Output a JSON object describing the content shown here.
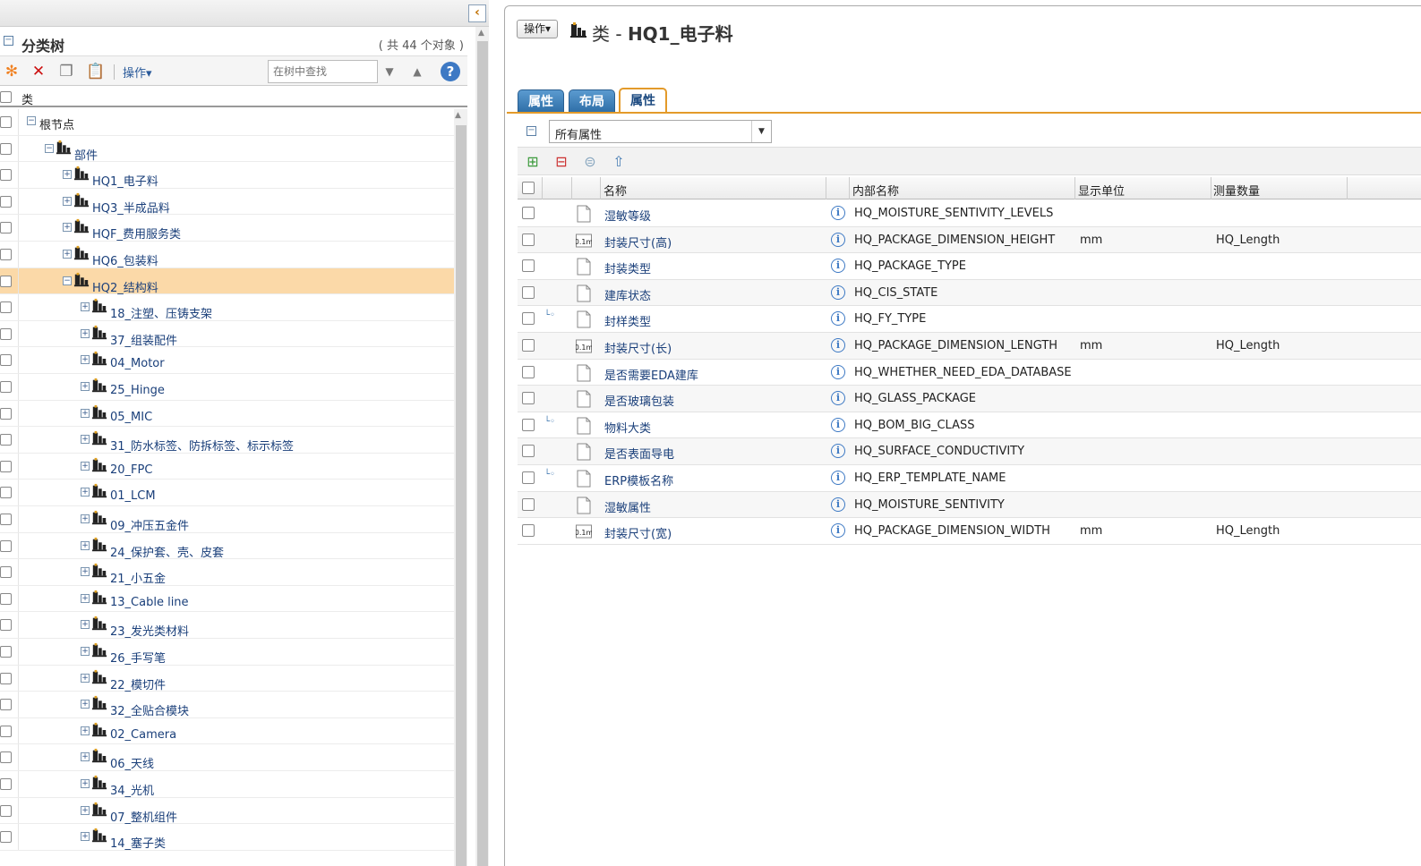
{
  "left_panel": {
    "tree_title": "分类树",
    "object_count": "( 共 44 个对象 )",
    "ops_label": "操作▾",
    "search_placeholder": "在树中查找",
    "column_label": "类",
    "tree": [
      {
        "label": "根节点",
        "level": 0,
        "icon": false,
        "selected": false
      },
      {
        "label": "部件",
        "level": 1,
        "icon": true,
        "selected": false
      },
      {
        "label": "HQ1_电子料",
        "level": 2,
        "icon": true,
        "selected": false
      },
      {
        "label": "HQ3_半成品料",
        "level": 2,
        "icon": true,
        "selected": false
      },
      {
        "label": "HQF_费用服务类",
        "level": 2,
        "icon": true,
        "selected": false
      },
      {
        "label": "HQ6_包装料",
        "level": 2,
        "icon": true,
        "selected": false
      },
      {
        "label": "HQ2_结构料",
        "level": 2,
        "icon": true,
        "selected": true
      },
      {
        "label": "18_注塑、压铸支架",
        "level": 3,
        "icon": true,
        "selected": false
      },
      {
        "label": "37_组装配件",
        "level": 3,
        "icon": true,
        "selected": false
      },
      {
        "label": "04_Motor",
        "level": 3,
        "icon": true,
        "selected": false
      },
      {
        "label": "25_Hinge",
        "level": 3,
        "icon": true,
        "selected": false
      },
      {
        "label": "05_MIC",
        "level": 3,
        "icon": true,
        "selected": false
      },
      {
        "label": "31_防水标签、防拆标签、标示标签",
        "level": 3,
        "icon": true,
        "selected": false
      },
      {
        "label": "20_FPC",
        "level": 3,
        "icon": true,
        "selected": false
      },
      {
        "label": "01_LCM",
        "level": 3,
        "icon": true,
        "selected": false
      },
      {
        "label": "09_冲压五金件",
        "level": 3,
        "icon": true,
        "selected": false
      },
      {
        "label": "24_保护套、壳、皮套",
        "level": 3,
        "icon": true,
        "selected": false
      },
      {
        "label": "21_小五金",
        "level": 3,
        "icon": true,
        "selected": false
      },
      {
        "label": "13_Cable line",
        "level": 3,
        "icon": true,
        "selected": false
      },
      {
        "label": "23_发光类材料",
        "level": 3,
        "icon": true,
        "selected": false
      },
      {
        "label": "26_手写笔",
        "level": 3,
        "icon": true,
        "selected": false
      },
      {
        "label": "22_模切件",
        "level": 3,
        "icon": true,
        "selected": false
      },
      {
        "label": "32_全贴合模块",
        "level": 3,
        "icon": true,
        "selected": false
      },
      {
        "label": "02_Camera",
        "level": 3,
        "icon": true,
        "selected": false
      },
      {
        "label": "06_天线",
        "level": 3,
        "icon": true,
        "selected": false
      },
      {
        "label": "34_光机",
        "level": 3,
        "icon": true,
        "selected": false
      },
      {
        "label": "07_整机组件",
        "level": 3,
        "icon": true,
        "selected": false
      },
      {
        "label": "14_塞子类",
        "level": 3,
        "icon": true,
        "selected": false
      }
    ]
  },
  "right_panel": {
    "ops_button": "操作▾",
    "title_prefix": "类 - ",
    "title_name": "HQ1_电子料",
    "tabs": [
      "属性",
      "布局",
      "属性"
    ],
    "active_tab": 2,
    "filter_value": "所有属性",
    "columns": {
      "name": "名称",
      "internal": "内部名称",
      "unit": "显示单位",
      "quantity": "测量数量"
    },
    "rows": [
      {
        "name": "湿敏等级",
        "internal": "HQ_MOISTURE_SENTIVITY_LEVELS",
        "unit": "",
        "quantity": "",
        "type": "doc",
        "inherit": false
      },
      {
        "name": "封装尺寸(高)",
        "internal": "HQ_PACKAGE_DIMENSION_HEIGHT",
        "unit": "mm",
        "quantity": "HQ_Length",
        "type": "num",
        "inherit": false
      },
      {
        "name": "封装类型",
        "internal": "HQ_PACKAGE_TYPE",
        "unit": "",
        "quantity": "",
        "type": "doc",
        "inherit": false
      },
      {
        "name": "建库状态",
        "internal": "HQ_CIS_STATE",
        "unit": "",
        "quantity": "",
        "type": "doc",
        "inherit": false
      },
      {
        "name": "封样类型",
        "internal": "HQ_FY_TYPE",
        "unit": "",
        "quantity": "",
        "type": "doc",
        "inherit": true
      },
      {
        "name": "封装尺寸(长)",
        "internal": "HQ_PACKAGE_DIMENSION_LENGTH",
        "unit": "mm",
        "quantity": "HQ_Length",
        "type": "num",
        "inherit": false
      },
      {
        "name": "是否需要EDA建库",
        "internal": "HQ_WHETHER_NEED_EDA_DATABASE",
        "unit": "",
        "quantity": "",
        "type": "doc",
        "inherit": false
      },
      {
        "name": "是否玻璃包装",
        "internal": "HQ_GLASS_PACKAGE",
        "unit": "",
        "quantity": "",
        "type": "doc",
        "inherit": false
      },
      {
        "name": "物料大类",
        "internal": "HQ_BOM_BIG_CLASS",
        "unit": "",
        "quantity": "",
        "type": "doc",
        "inherit": true
      },
      {
        "name": "是否表面导电",
        "internal": "HQ_SURFACE_CONDUCTIVITY",
        "unit": "",
        "quantity": "",
        "type": "doc",
        "inherit": false
      },
      {
        "name": "ERP模板名称",
        "internal": "HQ_ERP_TEMPLATE_NAME",
        "unit": "",
        "quantity": "",
        "type": "doc",
        "inherit": true
      },
      {
        "name": "湿敏属性",
        "internal": "HQ_MOISTURE_SENTIVITY",
        "unit": "",
        "quantity": "",
        "type": "doc",
        "inherit": false
      },
      {
        "name": "封装尺寸(宽)",
        "internal": "HQ_PACKAGE_DIMENSION_WIDTH",
        "unit": "mm",
        "quantity": "HQ_Length",
        "type": "num",
        "inherit": false
      }
    ],
    "num_icon_text": "0.1m"
  }
}
